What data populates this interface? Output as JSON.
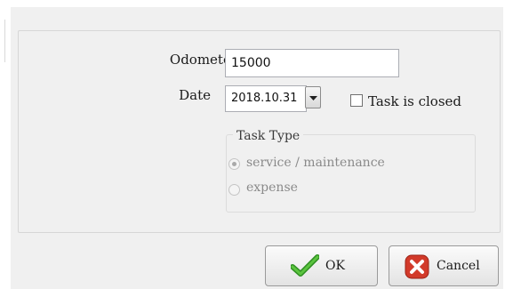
{
  "form": {
    "odometer_label": "Odometer",
    "odometer_value": "15000",
    "date_label": "Date",
    "date_value": "2018.10.31",
    "task_closed_label": "Task is closed",
    "task_closed_checked": false
  },
  "task_type": {
    "title": "Task Type",
    "options": [
      {
        "label": "service / maintenance",
        "selected": true,
        "enabled": false
      },
      {
        "label": "expense",
        "selected": false,
        "enabled": false
      }
    ]
  },
  "buttons": {
    "ok_label": "OK",
    "cancel_label": "Cancel"
  },
  "icons": {
    "date_dropdown": "chevron-down-icon",
    "ok": "checkmark-icon",
    "cancel": "cancel-x-icon"
  },
  "colors": {
    "ok_icon": "#3aa02a",
    "cancel_icon": "#d23a2a",
    "window_bg": "#f0f0f0"
  }
}
